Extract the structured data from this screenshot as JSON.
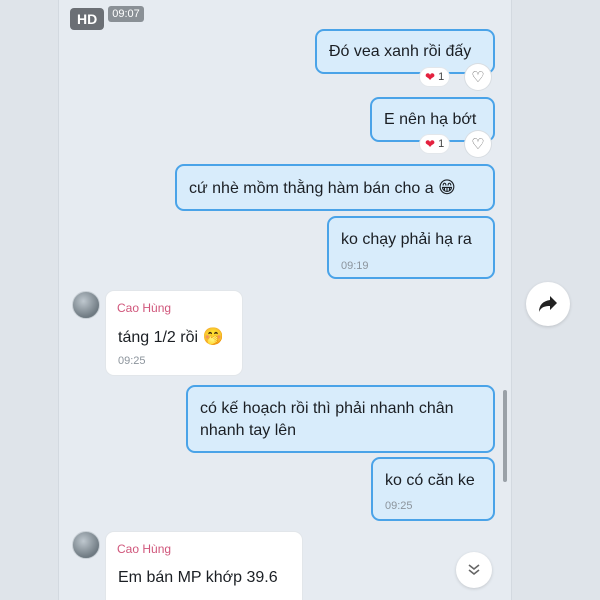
{
  "header": {
    "quality_badge": "HD",
    "timestamp": "09:07"
  },
  "messages": [
    {
      "text": "Đó vea xanh rồi đấy",
      "reaction_count": "1"
    },
    {
      "text": "E nên hạ bớt",
      "reaction_count": "1"
    },
    {
      "text": "cứ nhè mồm thằng hàm bán cho a",
      "emoji": "😁"
    },
    {
      "text": "ko chạy phải hạ ra",
      "time": "09:19"
    },
    {
      "sender": "Cao Hùng",
      "text": "táng 1/2 rồi",
      "emoji": "🤭",
      "time": "09:25"
    },
    {
      "line1": "có kế hoạch rồi thì phải nhanh chân",
      "line2": "nhanh tay lên"
    },
    {
      "text": "ko có căn ke",
      "time": "09:25"
    },
    {
      "sender": "Cao Hùng",
      "text": "Em bán MP khớp 39.6"
    }
  ],
  "icons": {
    "reaction": "heart-red-icon",
    "like": "heart-outline-icon",
    "forward": "share-arrow-icon",
    "scroll": "double-chevron-down-icon"
  },
  "colors": {
    "outgoing_bg": "#d8ecfb",
    "outgoing_border": "#4aa3e8",
    "sender_name": "#d0567b"
  }
}
